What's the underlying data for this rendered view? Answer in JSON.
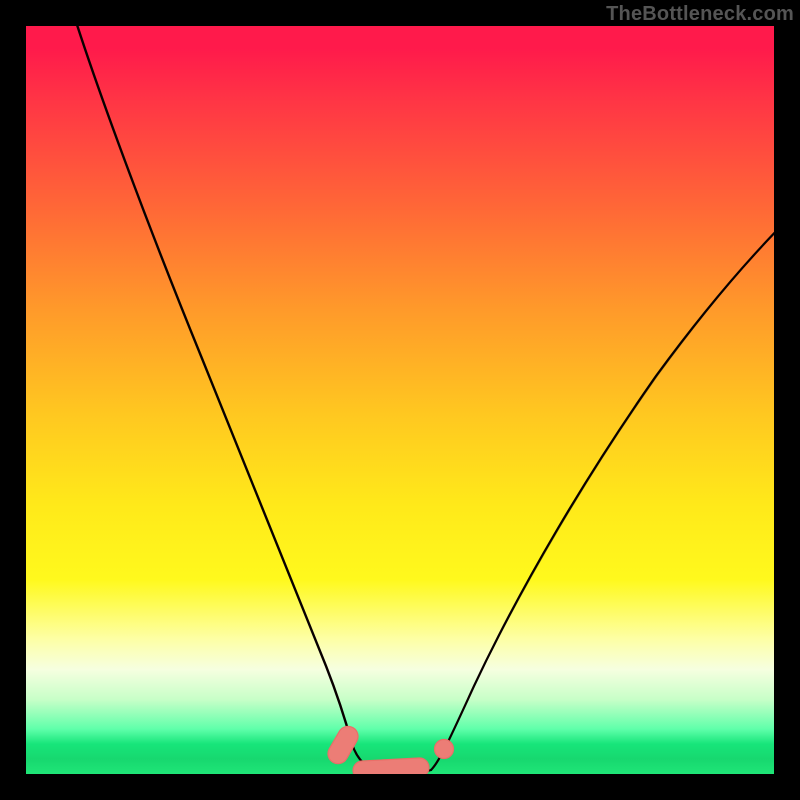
{
  "watermark": "TheBottleneck.com",
  "colors": {
    "frame": "#000000",
    "curve": "#080000",
    "marker_fill": "#ec7d76",
    "marker_stroke": "#ea6e68",
    "gradient_top": "#ff1a4b",
    "gradient_bottom": "#1fe577"
  },
  "chart_data": {
    "type": "line",
    "title": "",
    "xlabel": "",
    "ylabel": "",
    "xlim": [
      0,
      100
    ],
    "ylim": [
      0,
      100
    ],
    "grid": false,
    "legend": false,
    "series": [
      {
        "name": "left-branch",
        "x": [
          6,
          10,
          15,
          20,
          25,
          30,
          35,
          38,
          40,
          41.5,
          43
        ],
        "y": [
          100,
          90,
          78,
          66,
          54,
          41,
          28,
          18,
          10,
          4,
          0
        ]
      },
      {
        "name": "valley-floor",
        "x": [
          43,
          46,
          50,
          54
        ],
        "y": [
          0,
          0,
          0,
          0
        ]
      },
      {
        "name": "right-branch",
        "x": [
          54,
          56,
          60,
          65,
          70,
          75,
          80,
          85,
          90,
          95,
          100
        ],
        "y": [
          0,
          4,
          12,
          22,
          31,
          40,
          48,
          56,
          63,
          70,
          77
        ]
      }
    ],
    "markers": [
      {
        "name": "marker-left",
        "shape": "capsule",
        "x_range": [
          40.5,
          44.0
        ],
        "y": 2.0,
        "angle_deg": -60
      },
      {
        "name": "marker-middle",
        "shape": "capsule",
        "x_range": [
          44.0,
          53.5
        ],
        "y": 0.5,
        "angle_deg": -3
      },
      {
        "name": "marker-right",
        "shape": "dot",
        "x": 55.9,
        "y": 3.0
      }
    ],
    "background": {
      "type": "vertical-gradient",
      "stops": [
        {
          "pos": 0.0,
          "color": "#ff1a4b"
        },
        {
          "pos": 0.25,
          "color": "#ff6a36"
        },
        {
          "pos": 0.52,
          "color": "#ffc820"
        },
        {
          "pos": 0.74,
          "color": "#fff91d"
        },
        {
          "pos": 0.9,
          "color": "#c8ffc8"
        },
        {
          "pos": 1.0,
          "color": "#1fe577"
        }
      ]
    },
    "notes": "V-shaped bottleneck curve over a red→yellow→green vertical gradient. y values are percentage of chart height from bottom; curve descends from top-left, reaches a flat minimum around x≈43–54, then rises to the right reaching ≈77% height at x=100. Three salmon-colored rounded markers sit in the valley."
  }
}
